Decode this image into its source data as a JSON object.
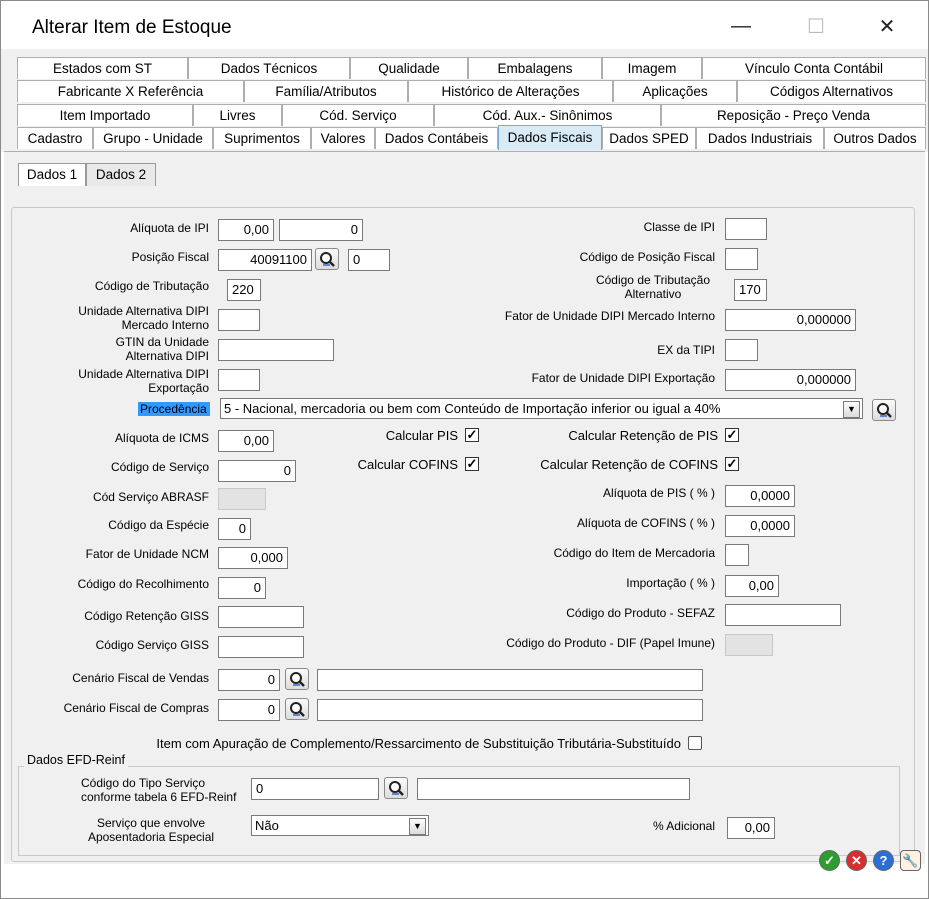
{
  "window": {
    "title": "Alterar Item de Estoque",
    "minimize": "—",
    "maximize": "☐",
    "close": "✕"
  },
  "tabs": {
    "row1": [
      "Estados com ST",
      "Dados Técnicos",
      "Qualidade",
      "Embalagens",
      "Imagem",
      "Vínculo Conta Contábil"
    ],
    "row2": [
      "Fabricante X Referência",
      "Família/Atributos",
      "Histórico de Alterações",
      "Aplicações",
      "Códigos Alternativos"
    ],
    "row3": [
      "Item Importado",
      "Livres",
      "Cód. Serviço",
      "Cód. Aux.- Sinônimos",
      "Reposição - Preço Venda"
    ],
    "row4": [
      "Cadastro",
      "Grupo - Unidade",
      "Suprimentos",
      "Valores",
      "Dados Contábeis",
      "Dados Fiscais",
      "Dados SPED",
      "Dados Industriais",
      "Outros Dados"
    ],
    "active": "Dados Fiscais"
  },
  "subtabs": [
    "Dados 1",
    "Dados 2"
  ],
  "form": {
    "aliquota_ipi": {
      "label": "Alíquota de IPI",
      "value1": "0,00",
      "value2": "0"
    },
    "posicao_fiscal": {
      "label": "Posição Fiscal",
      "value": "40091100",
      "value2": "0"
    },
    "codigo_tributacao": {
      "label": "Código de Tributação",
      "value": "220"
    },
    "unid_alt_dipi_mi": {
      "label_line1": "Unidade Alternativa DIPI",
      "label_line2": "Mercado Interno",
      "value": ""
    },
    "gtin_unid_alt": {
      "label_line1": "GTIN da Unidade",
      "label_line2": "Alternativa DIPI",
      "value": ""
    },
    "unid_alt_dipi_exp": {
      "label_line1": "Unidade Alternativa DIPI",
      "label_line2": "Exportação",
      "value": ""
    },
    "classe_ipi": {
      "label": "Classe de IPI",
      "value": ""
    },
    "codigo_posicao_fiscal": {
      "label": "Código de Posição Fiscal",
      "value": ""
    },
    "codigo_trib_alt": {
      "label_line1": "Código de Tributação",
      "label_line2": "Alternativo",
      "value": "170"
    },
    "fator_dipi_mi": {
      "label": "Fator de Unidade DIPI Mercado Interno",
      "value": "0,000000"
    },
    "ex_tipi": {
      "label": "EX da TIPI",
      "value": ""
    },
    "fator_dipi_exp": {
      "label": "Fator de Unidade DIPI Exportação",
      "value": "0,000000"
    },
    "procedencia": {
      "label": "Procedência",
      "value": "5 - Nacional, mercadoria ou bem com Conteúdo de Importação inferior ou igual a 40%"
    },
    "aliquota_icms": {
      "label": "Alíquota de ICMS",
      "value": "0,00"
    },
    "codigo_servico": {
      "label": "Código de Serviço",
      "value": "0"
    },
    "cod_servico_abrasf": {
      "label": "Cód Serviço ABRASF",
      "value": ""
    },
    "codigo_especie": {
      "label": "Código da Espécie",
      "value": "0"
    },
    "fator_ncm": {
      "label": "Fator de Unidade NCM",
      "value": "0,000"
    },
    "codigo_recolhimento": {
      "label": "Código do Recolhimento",
      "value": "0"
    },
    "codigo_retencao_giss": {
      "label": "Código Retenção GISS",
      "value": ""
    },
    "codigo_servico_giss": {
      "label": "Código Serviço GISS",
      "value": ""
    },
    "calcular_pis": {
      "label": "Calcular PIS",
      "checked": true
    },
    "calcular_cofins": {
      "label": "Calcular COFINS",
      "checked": true
    },
    "calc_ret_pis": {
      "label": "Calcular Retenção de PIS",
      "checked": true
    },
    "calc_ret_cofins": {
      "label": "Calcular Retenção de COFINS",
      "checked": true
    },
    "aliquota_pis": {
      "label": "Alíquota de PIS   ( % )",
      "value": "0,0000"
    },
    "aliquota_cofins": {
      "label": "Alíquota de COFINS  ( % )",
      "value": "0,0000"
    },
    "codigo_item_mercadoria": {
      "label": "Código do Item de Mercadoria",
      "value": ""
    },
    "importacao": {
      "label": "Importação  ( % )",
      "value": "0,00"
    },
    "codigo_produto_sefaz": {
      "label": "Código do Produto - SEFAZ",
      "value": ""
    },
    "codigo_produto_dif": {
      "label": "Código do Produto - DIF (Papel Imune)",
      "value": ""
    },
    "cenario_vendas": {
      "label": "Cenário Fiscal de Vendas",
      "value": "0",
      "desc": ""
    },
    "cenario_compras": {
      "label": "Cenário Fiscal de Compras",
      "value": "0",
      "desc": ""
    },
    "apuracao_st": {
      "label": "Item com Apuração de Complemento/Ressarcimento de Substituição Tributária-Substituído",
      "checked": false
    }
  },
  "efd_reinf": {
    "title": "Dados EFD-Reinf",
    "tipo_servico": {
      "label_line1": "Código do Tipo Serviço",
      "label_line2": "conforme tabela 6 EFD-Reinf",
      "value": "0",
      "desc": ""
    },
    "aposentadoria": {
      "label_line1": "Serviço que envolve",
      "label_line2": "Aposentadoria Especial",
      "value": "Não"
    },
    "adicional": {
      "label": "% Adicional",
      "value": "0,00"
    }
  },
  "colors": {
    "active_tab": "#d9ebf7",
    "procedencia_highlight": "#3399ff",
    "ok": "#2e9c2e",
    "cancel": "#d33030",
    "help": "#2b6fd6",
    "tools": "#e89a2c"
  }
}
